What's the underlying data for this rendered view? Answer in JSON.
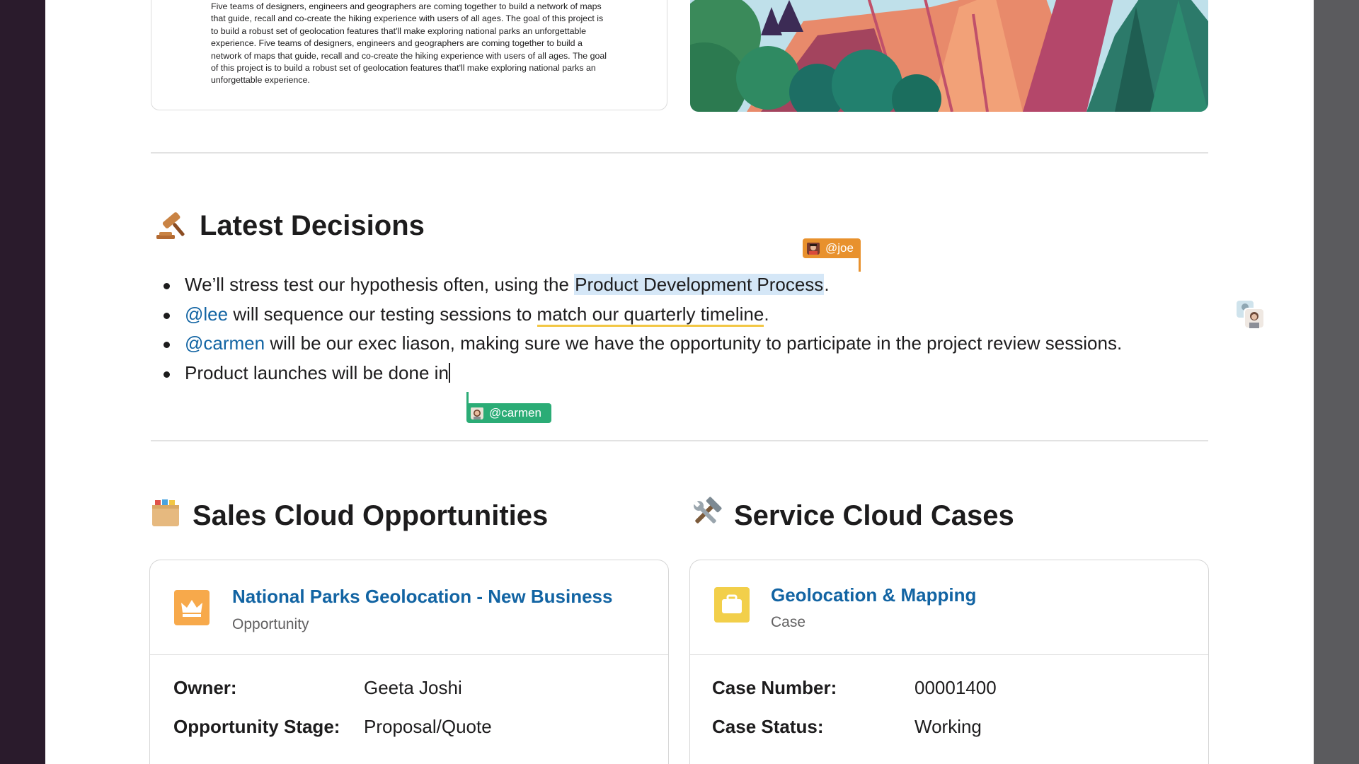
{
  "project": {
    "description": "Five teams of designers, engineers and geographers are coming together to build a network of maps that guide, recall and co-create the hiking experience with users of all ages. The goal of this project is to build a robust set of geolocation features that'll make exploring national parks an unforgettable experience. Five teams of designers, engineers and geographers are coming together to build a network of maps that guide, recall and co-create the hiking experience with users of all ages. The goal of this project is to build a robust set of geolocation features that'll make exploring national parks an unforgettable experience."
  },
  "decisions": {
    "title": "Latest Decisions",
    "icon": "gavel-icon",
    "items": [
      {
        "before": "We’ll stress test our hypothesis often, using the ",
        "highlight": "Product Development Process",
        "after": "."
      },
      {
        "mention": "@lee",
        "before": " will sequence our testing sessions to ",
        "underlined": "match our quarterly timeline",
        "after": "."
      },
      {
        "mention": "@carmen",
        "text": " will be our exec liason, making sure we have the opportunity to participate in the project review sessions."
      },
      {
        "text": "Product launches will be done in"
      }
    ]
  },
  "cursors": {
    "joe": {
      "label": "@joe",
      "color": "#e8912d"
    },
    "carmen": {
      "label": "@carmen",
      "color": "#2bac76"
    }
  },
  "sales": {
    "title": "Sales Cloud Opportunities",
    "icon": "file-box-icon",
    "card": {
      "name": "National Parks Geolocation - New Business",
      "type": "Opportunity",
      "icon": "crown-icon",
      "icon_color": "#f7a94b",
      "fields": [
        {
          "label": "Owner:",
          "value": "Geeta Joshi"
        },
        {
          "label": "Opportunity Stage:",
          "value": "Proposal/Quote"
        }
      ]
    }
  },
  "service": {
    "title": "Service Cloud Cases",
    "icon": "tools-icon",
    "card": {
      "name": "Geolocation & Mapping",
      "type": "Case",
      "icon": "briefcase-icon",
      "icon_color": "#f2cf4a",
      "fields": [
        {
          "label": "Case Number:",
          "value": "00001400"
        },
        {
          "label": "Case Status:",
          "value": "Working"
        }
      ]
    }
  }
}
